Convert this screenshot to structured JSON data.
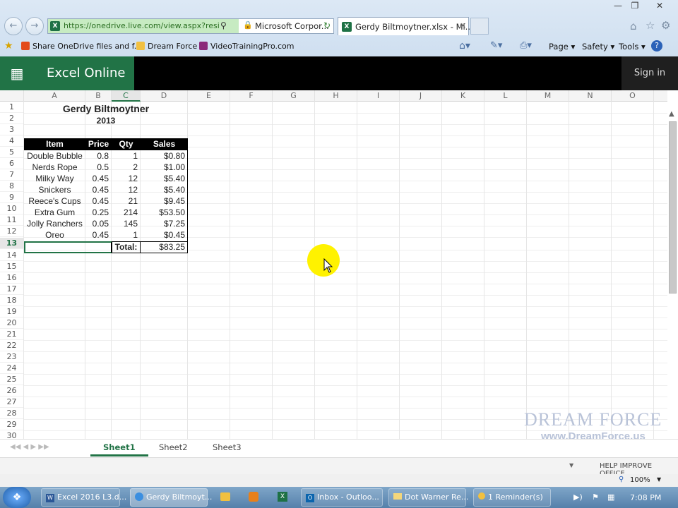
{
  "browser": {
    "url": "https://onedrive.live.com/view.aspx?resid=",
    "site_identity": "Microsoft Corpor...",
    "tab_title": "Gerdy Biltmoytner.xlsx - Mi...",
    "favorites": [
      "Share OneDrive files and f...",
      "Dream Force",
      "VideoTrainingPro.com"
    ],
    "tools": {
      "page": "Page",
      "safety": "Safety",
      "tools": "Tools"
    }
  },
  "app": {
    "name": "Excel Online",
    "signin": "Sign in"
  },
  "columns": [
    "A",
    "B",
    "C",
    "D",
    "E",
    "F",
    "G",
    "H",
    "I",
    "J",
    "K",
    "L",
    "M",
    "N",
    "O"
  ],
  "rows": [
    "1",
    "2",
    "3",
    "4",
    "5",
    "6",
    "7",
    "8",
    "9",
    "10",
    "11",
    "12",
    "13",
    "14",
    "15",
    "16",
    "17",
    "18",
    "19",
    "20",
    "21",
    "22",
    "23",
    "24",
    "25",
    "26",
    "27",
    "28",
    "29",
    "30"
  ],
  "sheet": {
    "title": "Gerdy Biltmoytner",
    "year": "2013",
    "headers": {
      "item": "Item",
      "price": "Price",
      "qty": "Qty",
      "sales": "Sales"
    },
    "data": [
      {
        "item": "Double Bubble",
        "price": "0.8",
        "qty": "1",
        "sales": "$0.80"
      },
      {
        "item": "Nerds Rope",
        "price": "0.5",
        "qty": "2",
        "sales": "$1.00"
      },
      {
        "item": "Milky Way",
        "price": "0.45",
        "qty": "12",
        "sales": "$5.40"
      },
      {
        "item": "Snickers",
        "price": "0.45",
        "qty": "12",
        "sales": "$5.40"
      },
      {
        "item": "Reece's Cups",
        "price": "0.45",
        "qty": "21",
        "sales": "$9.45"
      },
      {
        "item": "Extra Gum",
        "price": "0.25",
        "qty": "214",
        "sales": "$53.50"
      },
      {
        "item": "Jolly Ranchers",
        "price": "0.05",
        "qty": "145",
        "sales": "$7.25"
      },
      {
        "item": "Oreo",
        "price": "0.45",
        "qty": "1",
        "sales": "$0.45"
      }
    ],
    "total_label": "Total:",
    "total_value": "$83.25"
  },
  "sheet_tabs": [
    "Sheet1",
    "Sheet2",
    "Sheet3"
  ],
  "status": {
    "help": "HELP IMPROVE OFFICE",
    "zoom": "100%"
  },
  "watermark": {
    "brand": "DREAM FORCE",
    "url": "www.DreamForce.us"
  },
  "taskbar": {
    "items": [
      "Excel 2016 L3.d...",
      "Gerdy Biltmoyt...",
      "Inbox - Outloo...",
      "Dot Warner Re...",
      "1 Reminder(s)"
    ],
    "clock": "7:08 PM"
  },
  "colors": {
    "excel_green": "#217346",
    "highlight": "#fff200"
  }
}
